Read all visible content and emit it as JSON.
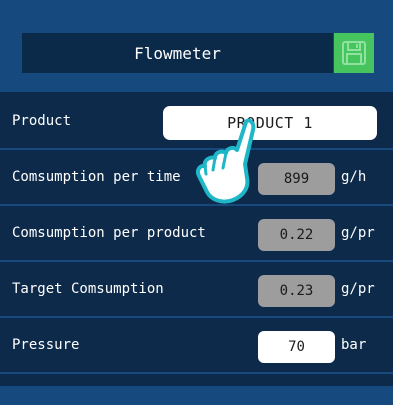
{
  "header": {
    "title": "Flowmeter",
    "save_icon": "floppy-disk-icon",
    "accent_color": "#46c45e"
  },
  "rows": [
    {
      "label": "Product",
      "value": "PRODUCT 1",
      "unit": ""
    },
    {
      "label": "Comsumption per time",
      "value": "899",
      "unit": "g/h"
    },
    {
      "label": "Comsumption per product",
      "value": "0.22",
      "unit": "g/pr"
    },
    {
      "label": "Target Comsumption",
      "value": "0.23",
      "unit": "g/pr"
    },
    {
      "label": "Pressure",
      "value": "70",
      "unit": "bar"
    }
  ],
  "overlay": {
    "pointer_icon": "tap-hand-icon"
  }
}
